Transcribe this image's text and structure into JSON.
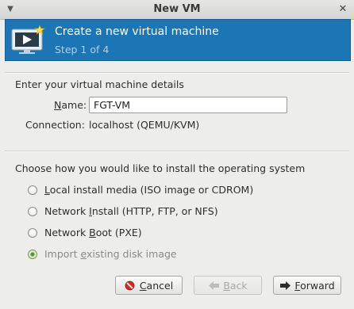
{
  "window": {
    "title": "New VM"
  },
  "banner": {
    "heading": "Create a new virtual machine",
    "step": "Step 1 of 4"
  },
  "details": {
    "section_title": "Enter your virtual machine details",
    "name_label": "Name:",
    "name_value": "FGT-VM",
    "connection_label": "Connection:",
    "connection_value": "localhost (QEMU/KVM)"
  },
  "install": {
    "section_title": "Choose how you would like to install the operating system",
    "options": [
      {
        "label": "Local install media (ISO image or CDROM)",
        "checked": false,
        "enabled": true
      },
      {
        "label": "Network Install (HTTP, FTP, or NFS)",
        "checked": false,
        "enabled": true
      },
      {
        "label": "Network Boot (PXE)",
        "checked": false,
        "enabled": true
      },
      {
        "label": "Import existing disk image",
        "checked": true,
        "enabled": false
      }
    ]
  },
  "buttons": {
    "cancel": "Cancel",
    "back": "Back",
    "forward": "Forward"
  },
  "colors": {
    "banner": "#1c75b4",
    "banner_step_text": "#a9d2ef"
  }
}
